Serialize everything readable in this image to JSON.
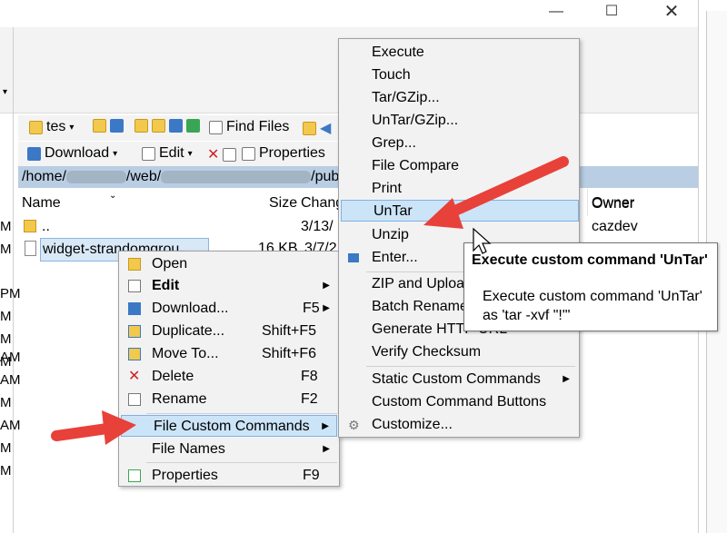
{
  "window": {
    "minimize_glyph": "—",
    "maximize_glyph": "☐",
    "close_glyph": "✕"
  },
  "ribbon": {
    "dropdown_glyph": "▾"
  },
  "toolbar": {
    "location": "tes",
    "find_files": "Find Files",
    "download": "Download",
    "edit": "Edit",
    "properties": "Properties"
  },
  "path": {
    "prefix": "/home/",
    "mid": "/web/",
    "suffix": "/publ"
  },
  "file_list": {
    "col_name": "Name",
    "col_size": "Size",
    "col_changed": "Chang",
    "col_owner": "Owner",
    "rows": [
      {
        "name": "..",
        "size": "",
        "changed": "3/13/",
        "owner": "cazdev"
      },
      {
        "name": "widget-strandomgrou",
        "size": "16 KB",
        "changed": "3/7/2",
        "owner": ""
      }
    ]
  },
  "left_times": [
    "M",
    "M",
    "PM",
    "M",
    "M",
    "M",
    "AM",
    "AM",
    "M",
    "AM",
    "M",
    "M"
  ],
  "context_menu": {
    "items": [
      {
        "label": "Open",
        "shortcut": "",
        "icon": "folder-open-icon"
      },
      {
        "label": "Edit",
        "shortcut": "",
        "icon": "edit-icon",
        "bold": true,
        "submenu": true
      },
      {
        "label": "Download...",
        "shortcut": "F5",
        "icon": "download-icon",
        "submenu": true
      },
      {
        "label": "Duplicate...",
        "shortcut": "Shift+F5",
        "icon": "duplicate-icon"
      },
      {
        "label": "Move To...",
        "shortcut": "Shift+F6",
        "icon": "move-icon"
      },
      {
        "label": "Delete",
        "shortcut": "F8",
        "icon": "delete-icon"
      },
      {
        "label": "Rename",
        "shortcut": "F2",
        "icon": "rename-icon"
      },
      {
        "label": "File Custom Commands",
        "shortcut": "",
        "icon": "",
        "submenu": true,
        "highlight": true
      },
      {
        "label": "File Names",
        "shortcut": "",
        "icon": "",
        "submenu": true
      },
      {
        "label": "Properties",
        "shortcut": "F9",
        "icon": "properties-icon"
      }
    ]
  },
  "submenu": {
    "items": [
      {
        "label": "Execute"
      },
      {
        "label": "Touch"
      },
      {
        "label": "Tar/GZip..."
      },
      {
        "label": "UnTar/GZip..."
      },
      {
        "label": "Grep..."
      },
      {
        "label": "File Compare"
      },
      {
        "label": "Print"
      },
      {
        "label": "UnTar",
        "highlight": true
      },
      {
        "label": "Unzip"
      },
      {
        "label": "Enter..."
      },
      {
        "label": "ZIP and Uploa"
      },
      {
        "label": "Batch Rename"
      },
      {
        "label": "Generate HTTP URL"
      },
      {
        "label": "Verify Checksum"
      },
      {
        "label": "Static Custom Commands",
        "submenu": true
      },
      {
        "label": "Custom Command Buttons"
      },
      {
        "label": "Customize..."
      }
    ]
  },
  "tooltip": {
    "title": "Execute custom command 'UnTar'",
    "body": "Execute custom command 'UnTar' as 'tar -xvf \"!\"'"
  },
  "colors": {
    "path_bar": "#b9cde3",
    "menu_bg": "#f2f2f2",
    "highlight": "#cce4f7",
    "arrow": "#e8413a"
  }
}
